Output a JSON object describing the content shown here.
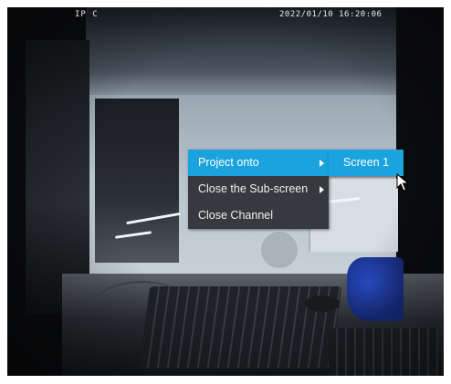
{
  "video": {
    "channel_label": "IP C",
    "timestamp": "2022/01/10 16:20:06"
  },
  "context_menu": {
    "items": [
      {
        "label": "Project onto",
        "has_submenu": true,
        "active": true
      },
      {
        "label": "Close the Sub-screen",
        "has_submenu": true,
        "active": false
      },
      {
        "label": "Close Channel",
        "has_submenu": false,
        "active": false
      }
    ],
    "submenu": {
      "items": [
        {
          "label": "Screen 1"
        }
      ]
    }
  },
  "colors": {
    "menu_background": "#36393d",
    "highlight": "#1aa3dd",
    "menu_text": "#f0f0f0"
  },
  "icons": {
    "submenu_arrow": "chevron-right-icon",
    "pointer": "mouse-cursor-icon"
  }
}
